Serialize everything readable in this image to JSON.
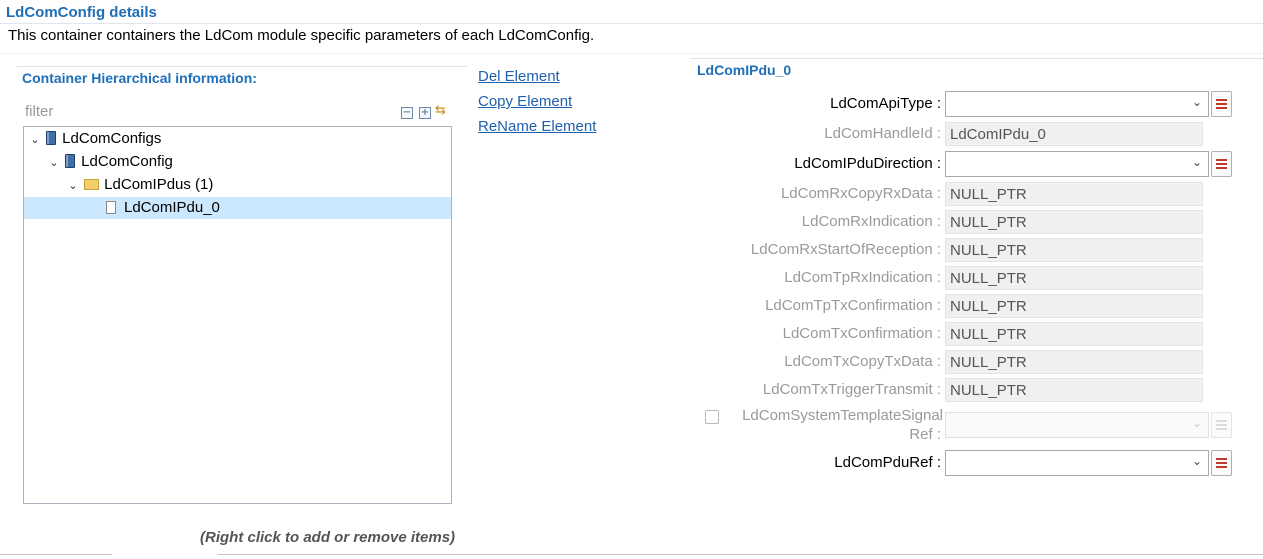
{
  "header": {
    "title": "LdComConfig details",
    "description": "This container containers the LdCom module specific parameters of each LdComConfig."
  },
  "left_panel": {
    "section_title": "Container Hierarchical information:",
    "filter_placeholder": "filter",
    "toolbar_icons": [
      "collapse-all-icon",
      "expand-all-icon",
      "link-editor-icon"
    ],
    "tree": [
      {
        "label": "LdComConfigs",
        "level": 0,
        "icon": "book-icon",
        "expanded": true
      },
      {
        "label": "LdComConfig",
        "level": 1,
        "icon": "book-icon",
        "expanded": true
      },
      {
        "label": "LdComIPdus (1)",
        "level": 2,
        "icon": "folder-icon",
        "expanded": true
      },
      {
        "label": "LdComIPdu_0",
        "level": 3,
        "icon": "file-icon",
        "selected": true
      }
    ],
    "hint": "(Right click to add or remove items)"
  },
  "actions": {
    "del": "Del Element",
    "copy": "Copy Element",
    "rename": "ReName Element"
  },
  "form": {
    "section_title": "LdComIPdu_0",
    "fields": [
      {
        "label": "LdComApiType :",
        "type": "combo",
        "value": "",
        "enabled": true
      },
      {
        "label": "LdComHandleId :",
        "type": "readonly",
        "value": "LdComIPdu_0",
        "enabled": false
      },
      {
        "label": "LdComIPduDirection :",
        "type": "combo",
        "value": "",
        "enabled": true
      },
      {
        "label": "LdComRxCopyRxData :",
        "type": "readonly",
        "value": "NULL_PTR",
        "enabled": false
      },
      {
        "label": "LdComRxIndication :",
        "type": "readonly",
        "value": "NULL_PTR",
        "enabled": false
      },
      {
        "label": "LdComRxStartOfReception :",
        "type": "readonly",
        "value": "NULL_PTR",
        "enabled": false
      },
      {
        "label": "LdComTpRxIndication :",
        "type": "readonly",
        "value": "NULL_PTR",
        "enabled": false
      },
      {
        "label": "LdComTpTxConfirmation :",
        "type": "readonly",
        "value": "NULL_PTR",
        "enabled": false
      },
      {
        "label": "LdComTxConfirmation :",
        "type": "readonly",
        "value": "NULL_PTR",
        "enabled": false
      },
      {
        "label": "LdComTxCopyTxData :",
        "type": "readonly",
        "value": "NULL_PTR",
        "enabled": false
      },
      {
        "label": "LdComTxTriggerTransmit :",
        "type": "readonly",
        "value": "NULL_PTR",
        "enabled": false
      }
    ],
    "system_template_ref": {
      "label_line1": "LdComSystemTemplateSignal",
      "label_line2": "Ref :",
      "checked": false,
      "enabled": false
    },
    "pdu_ref": {
      "label": "LdComPduRef :",
      "value": "",
      "enabled": true
    }
  }
}
